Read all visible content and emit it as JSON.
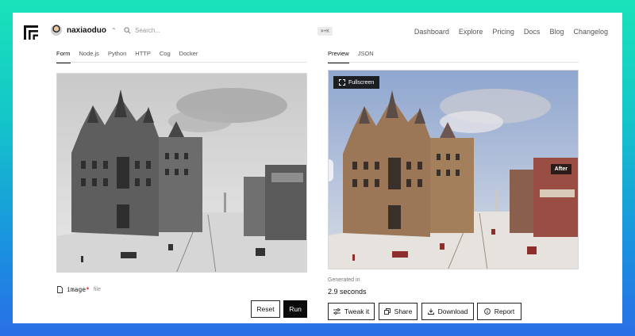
{
  "nav": {
    "username": "naxiaoduo",
    "search_placeholder": "Search...",
    "shortcut": "⌘+K",
    "links": [
      "Dashboard",
      "Explore",
      "Pricing",
      "Docs",
      "Blog",
      "Changelog"
    ]
  },
  "input_panel": {
    "tabs": [
      "Form",
      "Node.js",
      "Python",
      "HTTP",
      "Cog",
      "Docker"
    ],
    "active_tab": "Form",
    "field_name": "image",
    "field_required_mark": "*",
    "field_type": "file",
    "reset_label": "Reset",
    "run_label": "Run"
  },
  "output_panel": {
    "tabs": [
      "Preview",
      "JSON"
    ],
    "active_tab": "Preview",
    "fullscreen_label": "Fullscreen",
    "after_label": "After",
    "generated_label": "Generated in",
    "generated_value": "2.9 seconds",
    "actions": [
      {
        "label": "Tweak it",
        "icon": "sliders-icon"
      },
      {
        "label": "Share",
        "icon": "copy-icon"
      },
      {
        "label": "Download",
        "icon": "download-icon"
      },
      {
        "label": "Report",
        "icon": "info-icon"
      }
    ]
  },
  "colors": {
    "background_top": "#19e3b9",
    "background_bottom": "#2a6fe6",
    "primary_button": "#0a0a0a"
  }
}
